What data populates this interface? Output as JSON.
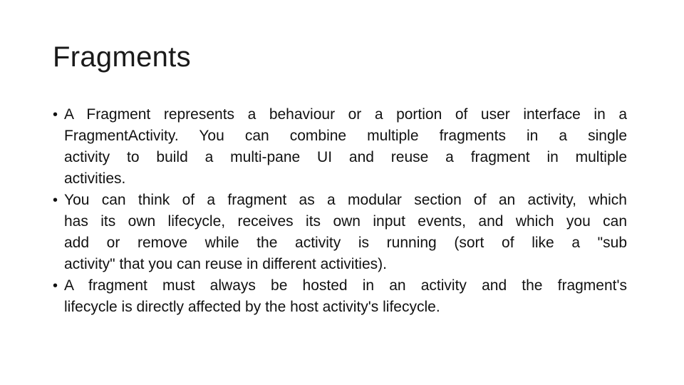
{
  "slide": {
    "title": "Fragments",
    "bullets": [
      {
        "lines": [
          "A Fragment represents a behaviour or a portion of user interface in a",
          "FragmentActivity. You can combine multiple fragments in a single",
          "activity to build a multi-pane UI and reuse a fragment in multiple",
          "activities."
        ]
      },
      {
        "lines": [
          "You can think of a fragment as a modular section of an activity, which",
          "has its own lifecycle, receives its own input events, and which you can",
          "add or remove while the activity is running (sort of like a \"sub",
          "activity\" that you can reuse in different activities)."
        ]
      },
      {
        "lines": [
          "A fragment must always be hosted in an activity and the fragment's",
          "lifecycle is directly affected by the host activity's lifecycle."
        ]
      }
    ],
    "bullet_glyph": "•"
  }
}
